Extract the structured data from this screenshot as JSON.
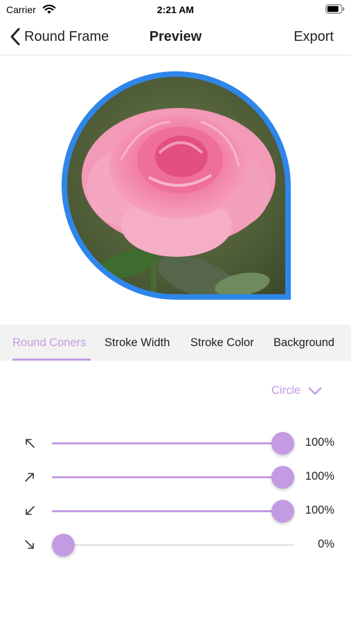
{
  "status_bar": {
    "carrier": "Carrier",
    "time": "2:21 AM"
  },
  "nav": {
    "back_label": "Round Frame",
    "title": "Preview",
    "export_label": "Export"
  },
  "preview": {
    "frame_color": "#2f86ea"
  },
  "tabs": [
    {
      "label": "Round Coners",
      "active": true
    },
    {
      "label": "Stroke Width",
      "active": false
    },
    {
      "label": "Stroke Color",
      "active": false
    },
    {
      "label": "Background",
      "active": false
    }
  ],
  "options": {
    "shape_label": "Circle"
  },
  "corners": [
    {
      "icon": "arrow-up-left-icon",
      "value": 1.0,
      "value_label": "100%"
    },
    {
      "icon": "arrow-up-right-icon",
      "value": 1.0,
      "value_label": "100%"
    },
    {
      "icon": "arrow-down-left-icon",
      "value": 1.0,
      "value_label": "100%"
    },
    {
      "icon": "arrow-down-right-icon",
      "value": 0.0,
      "value_label": "0%"
    }
  ],
  "colors": {
    "accent": "#c39be3",
    "frame": "#2f86ea",
    "tab_bar_bg": "#f2f2f2"
  }
}
